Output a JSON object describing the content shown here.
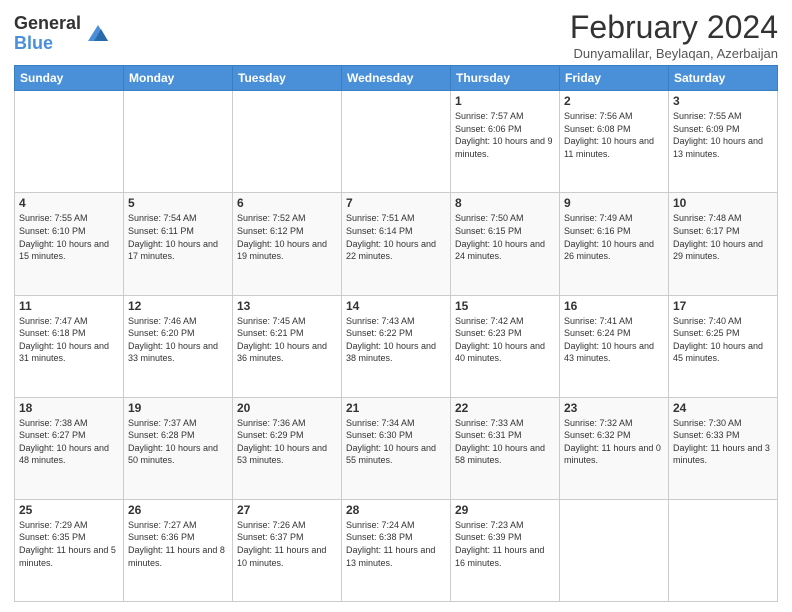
{
  "header": {
    "logo_general": "General",
    "logo_blue": "Blue",
    "month_year": "February 2024",
    "location": "Dunyamalilar, Beylaqan, Azerbaijan"
  },
  "days_of_week": [
    "Sunday",
    "Monday",
    "Tuesday",
    "Wednesday",
    "Thursday",
    "Friday",
    "Saturday"
  ],
  "weeks": [
    [
      {
        "num": "",
        "info": ""
      },
      {
        "num": "",
        "info": ""
      },
      {
        "num": "",
        "info": ""
      },
      {
        "num": "",
        "info": ""
      },
      {
        "num": "1",
        "info": "Sunrise: 7:57 AM\nSunset: 6:06 PM\nDaylight: 10 hours and 9 minutes."
      },
      {
        "num": "2",
        "info": "Sunrise: 7:56 AM\nSunset: 6:08 PM\nDaylight: 10 hours and 11 minutes."
      },
      {
        "num": "3",
        "info": "Sunrise: 7:55 AM\nSunset: 6:09 PM\nDaylight: 10 hours and 13 minutes."
      }
    ],
    [
      {
        "num": "4",
        "info": "Sunrise: 7:55 AM\nSunset: 6:10 PM\nDaylight: 10 hours and 15 minutes."
      },
      {
        "num": "5",
        "info": "Sunrise: 7:54 AM\nSunset: 6:11 PM\nDaylight: 10 hours and 17 minutes."
      },
      {
        "num": "6",
        "info": "Sunrise: 7:52 AM\nSunset: 6:12 PM\nDaylight: 10 hours and 19 minutes."
      },
      {
        "num": "7",
        "info": "Sunrise: 7:51 AM\nSunset: 6:14 PM\nDaylight: 10 hours and 22 minutes."
      },
      {
        "num": "8",
        "info": "Sunrise: 7:50 AM\nSunset: 6:15 PM\nDaylight: 10 hours and 24 minutes."
      },
      {
        "num": "9",
        "info": "Sunrise: 7:49 AM\nSunset: 6:16 PM\nDaylight: 10 hours and 26 minutes."
      },
      {
        "num": "10",
        "info": "Sunrise: 7:48 AM\nSunset: 6:17 PM\nDaylight: 10 hours and 29 minutes."
      }
    ],
    [
      {
        "num": "11",
        "info": "Sunrise: 7:47 AM\nSunset: 6:18 PM\nDaylight: 10 hours and 31 minutes."
      },
      {
        "num": "12",
        "info": "Sunrise: 7:46 AM\nSunset: 6:20 PM\nDaylight: 10 hours and 33 minutes."
      },
      {
        "num": "13",
        "info": "Sunrise: 7:45 AM\nSunset: 6:21 PM\nDaylight: 10 hours and 36 minutes."
      },
      {
        "num": "14",
        "info": "Sunrise: 7:43 AM\nSunset: 6:22 PM\nDaylight: 10 hours and 38 minutes."
      },
      {
        "num": "15",
        "info": "Sunrise: 7:42 AM\nSunset: 6:23 PM\nDaylight: 10 hours and 40 minutes."
      },
      {
        "num": "16",
        "info": "Sunrise: 7:41 AM\nSunset: 6:24 PM\nDaylight: 10 hours and 43 minutes."
      },
      {
        "num": "17",
        "info": "Sunrise: 7:40 AM\nSunset: 6:25 PM\nDaylight: 10 hours and 45 minutes."
      }
    ],
    [
      {
        "num": "18",
        "info": "Sunrise: 7:38 AM\nSunset: 6:27 PM\nDaylight: 10 hours and 48 minutes."
      },
      {
        "num": "19",
        "info": "Sunrise: 7:37 AM\nSunset: 6:28 PM\nDaylight: 10 hours and 50 minutes."
      },
      {
        "num": "20",
        "info": "Sunrise: 7:36 AM\nSunset: 6:29 PM\nDaylight: 10 hours and 53 minutes."
      },
      {
        "num": "21",
        "info": "Sunrise: 7:34 AM\nSunset: 6:30 PM\nDaylight: 10 hours and 55 minutes."
      },
      {
        "num": "22",
        "info": "Sunrise: 7:33 AM\nSunset: 6:31 PM\nDaylight: 10 hours and 58 minutes."
      },
      {
        "num": "23",
        "info": "Sunrise: 7:32 AM\nSunset: 6:32 PM\nDaylight: 11 hours and 0 minutes."
      },
      {
        "num": "24",
        "info": "Sunrise: 7:30 AM\nSunset: 6:33 PM\nDaylight: 11 hours and 3 minutes."
      }
    ],
    [
      {
        "num": "25",
        "info": "Sunrise: 7:29 AM\nSunset: 6:35 PM\nDaylight: 11 hours and 5 minutes."
      },
      {
        "num": "26",
        "info": "Sunrise: 7:27 AM\nSunset: 6:36 PM\nDaylight: 11 hours and 8 minutes."
      },
      {
        "num": "27",
        "info": "Sunrise: 7:26 AM\nSunset: 6:37 PM\nDaylight: 11 hours and 10 minutes."
      },
      {
        "num": "28",
        "info": "Sunrise: 7:24 AM\nSunset: 6:38 PM\nDaylight: 11 hours and 13 minutes."
      },
      {
        "num": "29",
        "info": "Sunrise: 7:23 AM\nSunset: 6:39 PM\nDaylight: 11 hours and 16 minutes."
      },
      {
        "num": "",
        "info": ""
      },
      {
        "num": "",
        "info": ""
      }
    ]
  ]
}
